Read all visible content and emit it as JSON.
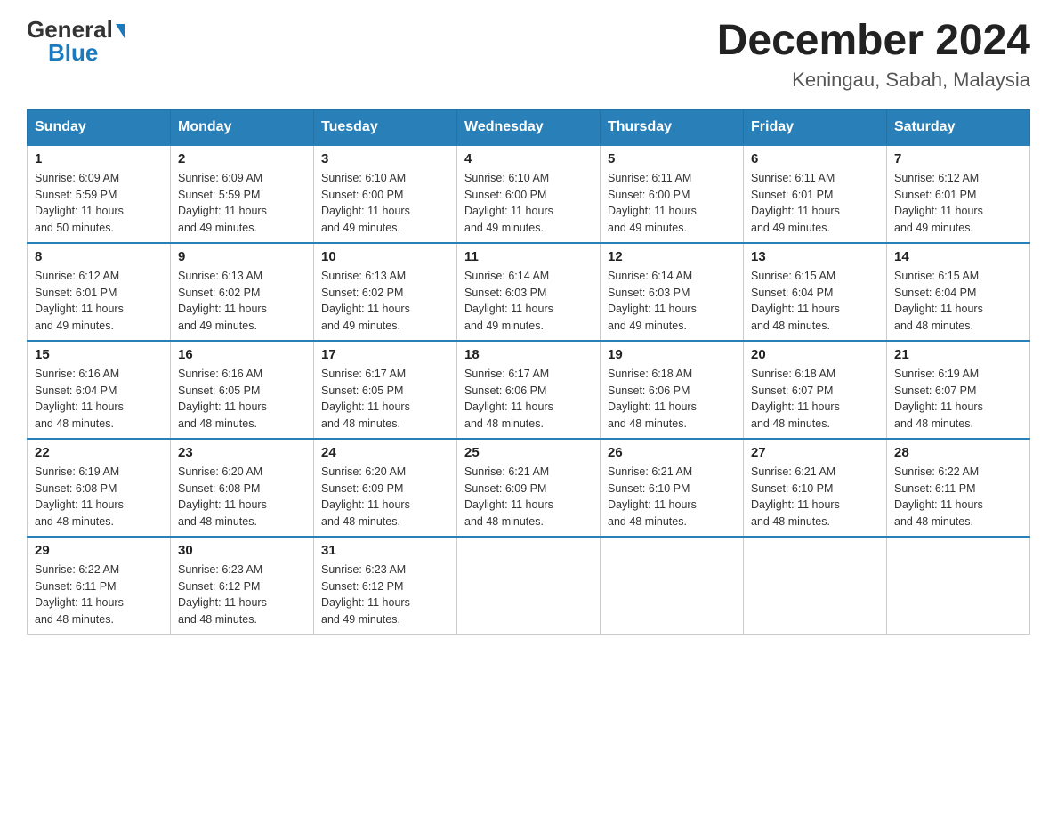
{
  "header": {
    "logo_general": "General",
    "logo_blue": "Blue",
    "month_title": "December 2024",
    "location": "Keningau, Sabah, Malaysia"
  },
  "days_of_week": [
    "Sunday",
    "Monday",
    "Tuesday",
    "Wednesday",
    "Thursday",
    "Friday",
    "Saturday"
  ],
  "weeks": [
    [
      {
        "day": "1",
        "sunrise": "6:09 AM",
        "sunset": "5:59 PM",
        "daylight": "11 hours and 50 minutes."
      },
      {
        "day": "2",
        "sunrise": "6:09 AM",
        "sunset": "5:59 PM",
        "daylight": "11 hours and 49 minutes."
      },
      {
        "day": "3",
        "sunrise": "6:10 AM",
        "sunset": "6:00 PM",
        "daylight": "11 hours and 49 minutes."
      },
      {
        "day": "4",
        "sunrise": "6:10 AM",
        "sunset": "6:00 PM",
        "daylight": "11 hours and 49 minutes."
      },
      {
        "day": "5",
        "sunrise": "6:11 AM",
        "sunset": "6:00 PM",
        "daylight": "11 hours and 49 minutes."
      },
      {
        "day": "6",
        "sunrise": "6:11 AM",
        "sunset": "6:01 PM",
        "daylight": "11 hours and 49 minutes."
      },
      {
        "day": "7",
        "sunrise": "6:12 AM",
        "sunset": "6:01 PM",
        "daylight": "11 hours and 49 minutes."
      }
    ],
    [
      {
        "day": "8",
        "sunrise": "6:12 AM",
        "sunset": "6:01 PM",
        "daylight": "11 hours and 49 minutes."
      },
      {
        "day": "9",
        "sunrise": "6:13 AM",
        "sunset": "6:02 PM",
        "daylight": "11 hours and 49 minutes."
      },
      {
        "day": "10",
        "sunrise": "6:13 AM",
        "sunset": "6:02 PM",
        "daylight": "11 hours and 49 minutes."
      },
      {
        "day": "11",
        "sunrise": "6:14 AM",
        "sunset": "6:03 PM",
        "daylight": "11 hours and 49 minutes."
      },
      {
        "day": "12",
        "sunrise": "6:14 AM",
        "sunset": "6:03 PM",
        "daylight": "11 hours and 49 minutes."
      },
      {
        "day": "13",
        "sunrise": "6:15 AM",
        "sunset": "6:04 PM",
        "daylight": "11 hours and 48 minutes."
      },
      {
        "day": "14",
        "sunrise": "6:15 AM",
        "sunset": "6:04 PM",
        "daylight": "11 hours and 48 minutes."
      }
    ],
    [
      {
        "day": "15",
        "sunrise": "6:16 AM",
        "sunset": "6:04 PM",
        "daylight": "11 hours and 48 minutes."
      },
      {
        "day": "16",
        "sunrise": "6:16 AM",
        "sunset": "6:05 PM",
        "daylight": "11 hours and 48 minutes."
      },
      {
        "day": "17",
        "sunrise": "6:17 AM",
        "sunset": "6:05 PM",
        "daylight": "11 hours and 48 minutes."
      },
      {
        "day": "18",
        "sunrise": "6:17 AM",
        "sunset": "6:06 PM",
        "daylight": "11 hours and 48 minutes."
      },
      {
        "day": "19",
        "sunrise": "6:18 AM",
        "sunset": "6:06 PM",
        "daylight": "11 hours and 48 minutes."
      },
      {
        "day": "20",
        "sunrise": "6:18 AM",
        "sunset": "6:07 PM",
        "daylight": "11 hours and 48 minutes."
      },
      {
        "day": "21",
        "sunrise": "6:19 AM",
        "sunset": "6:07 PM",
        "daylight": "11 hours and 48 minutes."
      }
    ],
    [
      {
        "day": "22",
        "sunrise": "6:19 AM",
        "sunset": "6:08 PM",
        "daylight": "11 hours and 48 minutes."
      },
      {
        "day": "23",
        "sunrise": "6:20 AM",
        "sunset": "6:08 PM",
        "daylight": "11 hours and 48 minutes."
      },
      {
        "day": "24",
        "sunrise": "6:20 AM",
        "sunset": "6:09 PM",
        "daylight": "11 hours and 48 minutes."
      },
      {
        "day": "25",
        "sunrise": "6:21 AM",
        "sunset": "6:09 PM",
        "daylight": "11 hours and 48 minutes."
      },
      {
        "day": "26",
        "sunrise": "6:21 AM",
        "sunset": "6:10 PM",
        "daylight": "11 hours and 48 minutes."
      },
      {
        "day": "27",
        "sunrise": "6:21 AM",
        "sunset": "6:10 PM",
        "daylight": "11 hours and 48 minutes."
      },
      {
        "day": "28",
        "sunrise": "6:22 AM",
        "sunset": "6:11 PM",
        "daylight": "11 hours and 48 minutes."
      }
    ],
    [
      {
        "day": "29",
        "sunrise": "6:22 AM",
        "sunset": "6:11 PM",
        "daylight": "11 hours and 48 minutes."
      },
      {
        "day": "30",
        "sunrise": "6:23 AM",
        "sunset": "6:12 PM",
        "daylight": "11 hours and 48 minutes."
      },
      {
        "day": "31",
        "sunrise": "6:23 AM",
        "sunset": "6:12 PM",
        "daylight": "11 hours and 49 minutes."
      },
      null,
      null,
      null,
      null
    ]
  ],
  "sunrise_label": "Sunrise:",
  "sunset_label": "Sunset:",
  "daylight_label": "Daylight:"
}
